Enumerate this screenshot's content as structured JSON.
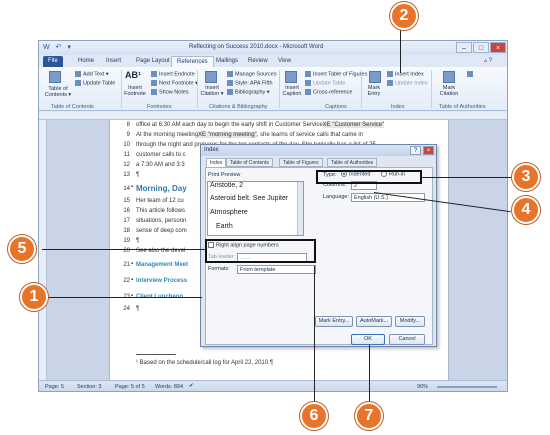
{
  "window": {
    "title": "Reflecting on Success 2010.docx - Microsoft Word",
    "qat": "W  ↶ ▾"
  },
  "tabs": [
    "File",
    "Home",
    "Insert",
    "Page Layout",
    "References",
    "Mailings",
    "Review",
    "View"
  ],
  "ribbon": {
    "toc": {
      "label": "Table of Contents ▾",
      "add_text": "Add Text ▾",
      "update_table": "Update Table",
      "group": "Table of Contents"
    },
    "footnotes": {
      "insert_footnote": "Insert Footnote",
      "insert_endnote": "Insert Endnote",
      "next_footnote": "Next Footnote ▾",
      "show_notes": "Show Notes",
      "group": "Footnotes",
      "ab_label": "AB¹"
    },
    "citations": {
      "insert_citation": "Insert Citation ▾",
      "manage_sources": "Manage Sources",
      "style_label": "Style:",
      "style_value": "APA Fifth",
      "bibliography": "Bibliography ▾",
      "group": "Citations & Bibliography"
    },
    "captions": {
      "insert_caption": "Insert Caption",
      "insert_table_figures": "Insert Table of Figures",
      "update_table": "Update Table",
      "cross_reference": "Cross-reference",
      "group": "Captions"
    },
    "index": {
      "mark_entry": "Mark Entry",
      "insert_index": "Insert Index",
      "update_index": "Update Index",
      "group": "Index"
    },
    "authorities": {
      "mark_citation": "Mark Citation",
      "group": "Table of Authorities"
    }
  },
  "document": {
    "lines": [
      {
        "num": "8",
        "text": "office at 6:30 AM each day to begin the early shift in Customer Service",
        "field": "XE \"Customer Service\""
      },
      {
        "num": "9",
        "text": "At the morning meeting",
        "field": "XE \"morning meeting\"",
        "tail": ", she learns of service calls that came in"
      },
      {
        "num": "10",
        "text": "through the night and prepares for the top contacts of the day. She typically has a list of 25"
      },
      {
        "num": "11",
        "text": "customer calls to c"
      },
      {
        "num": "12",
        "text": "a 7:30 AM and 3:3"
      },
      {
        "num": "13",
        "text": "¶"
      },
      {
        "num": "14",
        "text": "Morning, Day",
        "heading": true
      },
      {
        "num": "15",
        "text": "Her team of 12 cu"
      },
      {
        "num": "16",
        "text": "This article follows"
      },
      {
        "num": "17",
        "text": "situations, personn"
      },
      {
        "num": "18",
        "text": "sense of deep com"
      },
      {
        "num": "19",
        "text": "¶"
      },
      {
        "num": "20",
        "text": "See also the devel"
      },
      {
        "num": "21",
        "text": "Management Meet",
        "link": true
      },
      {
        "num": "22",
        "text": "Interview Process",
        "link": true
      },
      {
        "num": "23",
        "text": "Client Luncheon",
        "link": true
      },
      {
        "num": "24",
        "text": "¶"
      }
    ],
    "footnote": "¹ Based on the schedule/call log for April 22, 2010.¶"
  },
  "status": {
    "page": "Page: 5",
    "section": "Section: 3",
    "pages": "Page: 5 of 5",
    "words": "Words: 894",
    "zoom": "90%"
  },
  "dialog": {
    "title": "Index",
    "help": "?",
    "close": "×",
    "tabs": [
      "Index",
      "Table of Contents",
      "Table of Figures",
      "Table of Authorities"
    ],
    "print_preview_label": "Print Preview",
    "preview": [
      "Aristotle, 2",
      "Asteroid belt. See Jupiter",
      "Atmosphere",
      "Earth"
    ],
    "type_label": "Type:",
    "indented": "Indented",
    "runin": "Run-in",
    "columns_label": "Columns:",
    "columns_value": "2",
    "language_label": "Language:",
    "language_value": "English (U.S.)",
    "right_align": "Right align page numbers",
    "tab_leader_label": "Tab leader:",
    "tab_leader_value": ".......",
    "formats_label": "Formats:",
    "formats_value": "From template",
    "mark_entry": "Mark Entry...",
    "automark": "AutoMark...",
    "modify": "Modify...",
    "ok": "OK",
    "cancel": "Cancel"
  },
  "callouts": [
    "1",
    "2",
    "3",
    "4",
    "5",
    "6",
    "7"
  ],
  "colors": {
    "callout": "#e8742a",
    "file_tab": "#2b579a",
    "heading": "#2f7aa8"
  }
}
